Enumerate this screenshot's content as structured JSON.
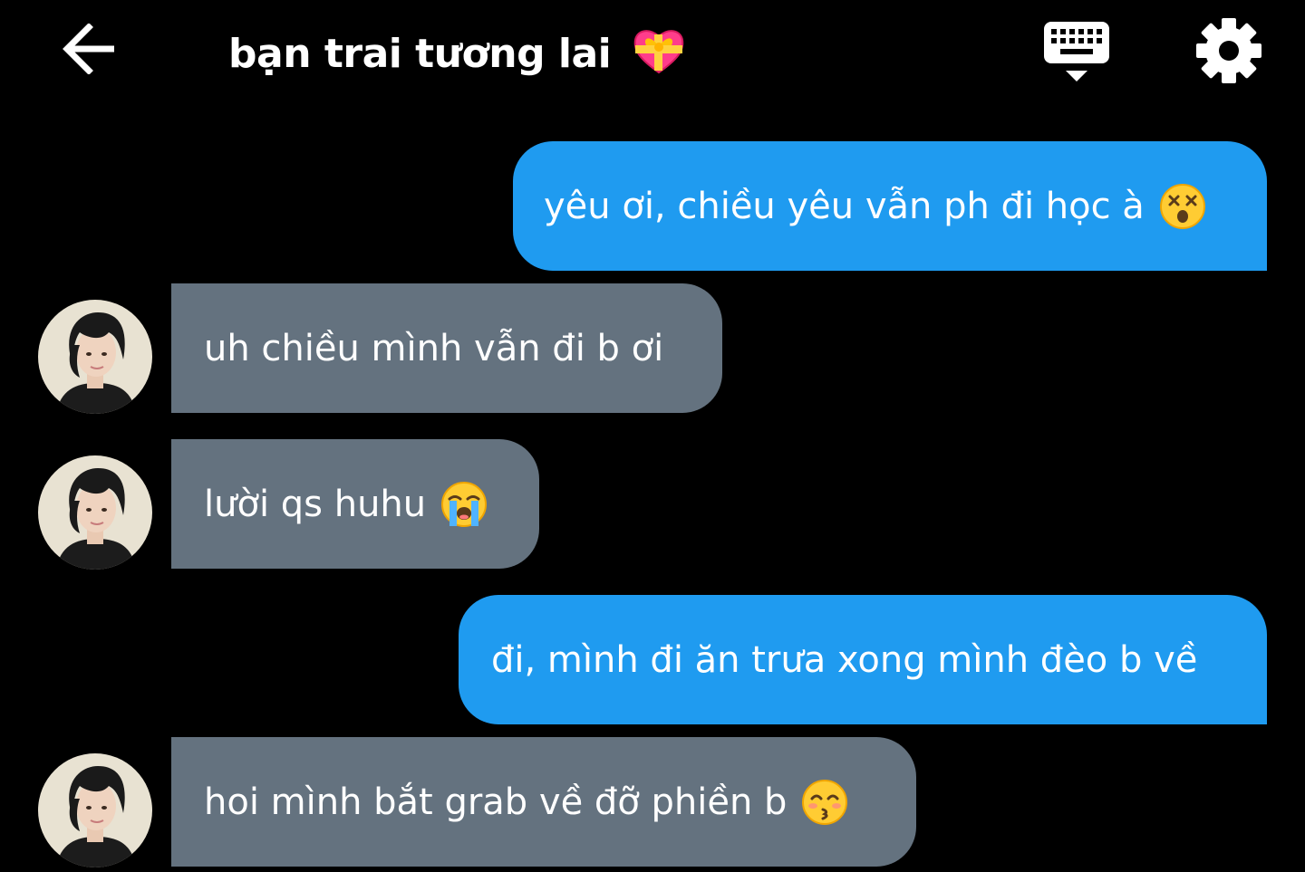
{
  "header": {
    "title": "bạn trai tương lai",
    "title_emoji": "heart-with-ribbon-emoji",
    "back_icon": "arrow-left-icon",
    "keyboard_icon": "keyboard-icon",
    "settings_icon": "gear-icon"
  },
  "colors": {
    "background": "#000000",
    "sent_bubble": "#1f9bf0",
    "received_bubble": "#64727f",
    "text": "#ffffff"
  },
  "messages": [
    {
      "side": "sent",
      "text": "yêu ơi, chiều yêu vẫn ph đi học à",
      "emoji": "dizzy-face-emoji"
    },
    {
      "side": "received",
      "text": "uh chiều mình vẫn đi b ơi",
      "emoji": ""
    },
    {
      "side": "received",
      "text": "lười qs huhu",
      "emoji": "loudly-crying-face-emoji"
    },
    {
      "side": "sent",
      "text": "đi, mình đi ăn trưa xong mình đèo b về",
      "emoji": ""
    },
    {
      "side": "received",
      "text": "hoi mình bắt grab về đỡ phiền b",
      "emoji": "kissing-face-closed-eyes-emoji"
    }
  ]
}
